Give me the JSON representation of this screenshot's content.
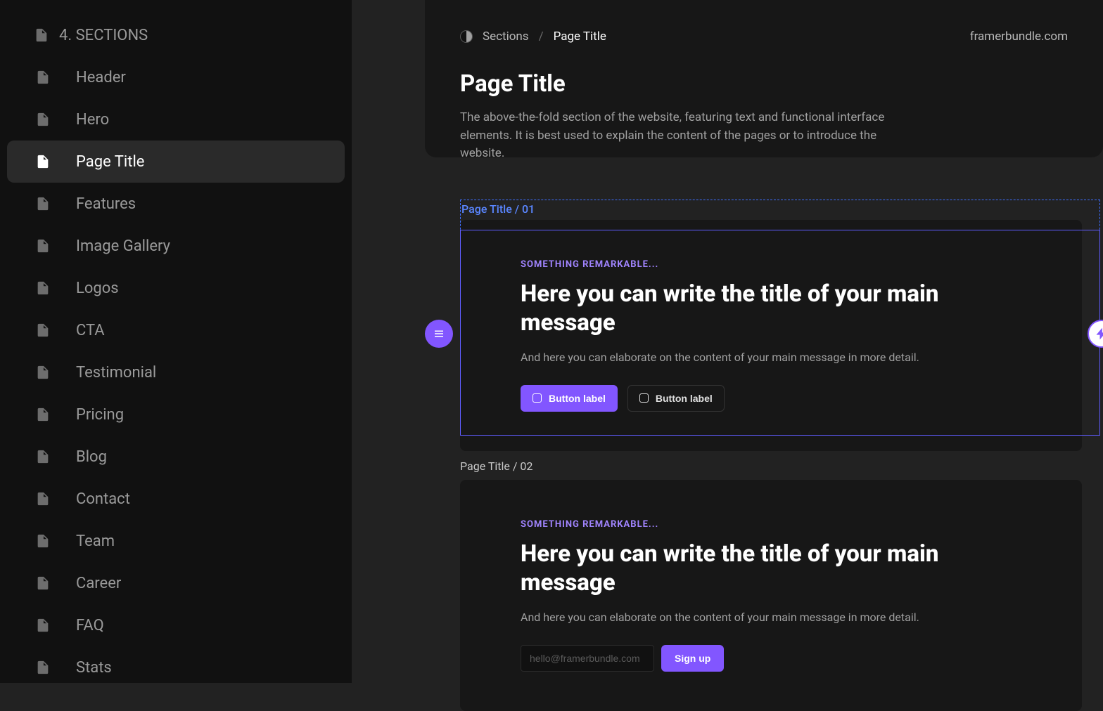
{
  "sidebar": {
    "header": "4. SECTIONS",
    "items": [
      {
        "label": "Header"
      },
      {
        "label": "Hero"
      },
      {
        "label": "Page Title",
        "active": true
      },
      {
        "label": "Features"
      },
      {
        "label": "Image Gallery"
      },
      {
        "label": "Logos"
      },
      {
        "label": "CTA"
      },
      {
        "label": "Testimonial"
      },
      {
        "label": "Pricing"
      },
      {
        "label": "Blog"
      },
      {
        "label": "Contact"
      },
      {
        "label": "Team"
      },
      {
        "label": "Career"
      },
      {
        "label": "FAQ"
      },
      {
        "label": "Stats"
      }
    ]
  },
  "header": {
    "breadcrumb_root": "Sections",
    "breadcrumb_sep": "/",
    "breadcrumb_current": "Page Title",
    "site": "framerbundle.com",
    "title": "Page Title",
    "desc": "The above-the-fold section of the website, featuring text and functional interface elements. It is best used to explain the content of the pages or to introduce the website."
  },
  "sections": [
    {
      "label": "Page Title / 01",
      "eyebrow": "SOMETHING REMARKABLE...",
      "headline": "Here you can write the title of your main message",
      "subtext": "And here you can elaborate on the content of your main message in more detail.",
      "primary_button": "Button label",
      "secondary_button": "Button label"
    },
    {
      "label": "Page Title / 02",
      "eyebrow": "SOMETHING REMARKABLE...",
      "headline": "Here you can write the title of your main message",
      "subtext": "And here you can elaborate on the content of your main message in more detail.",
      "email_placeholder": "hello@framerbundle.com",
      "signup_button": "Sign up"
    }
  ]
}
